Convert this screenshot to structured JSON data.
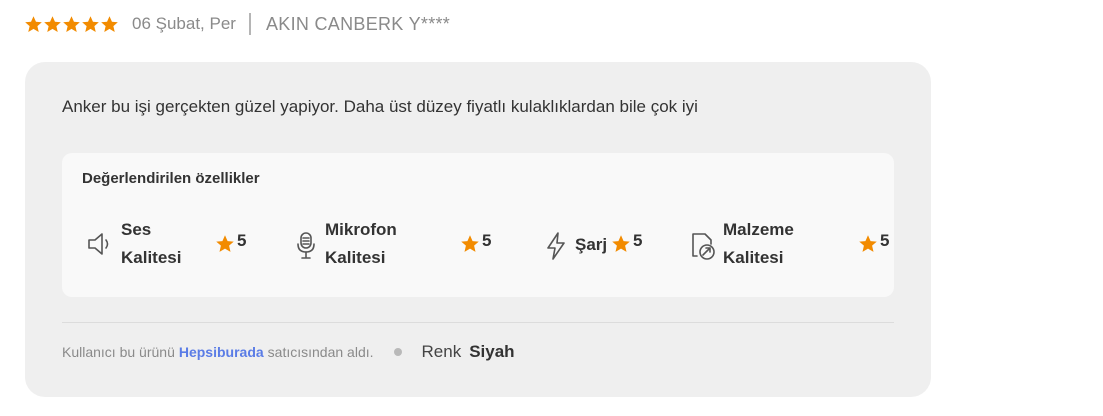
{
  "review": {
    "rating": 5,
    "rating_max": 5,
    "date": "06 Şubat, Per",
    "author": "AKIN CANBERK Y****",
    "comment": "Anker bu işi gerçekten güzel yapiyor. Daha üst düzey fiyatlı kulaklıklardan bile çok iyi"
  },
  "features": {
    "title": "Değerlendirilen özellikler",
    "items": [
      {
        "line1": "Ses",
        "line2": "Kalitesi",
        "score": "5",
        "icon": "speaker-icon"
      },
      {
        "line1": "Mikrofon",
        "line2": "Kalitesi",
        "score": "5",
        "icon": "microphone-icon"
      },
      {
        "line1": "Şarj",
        "line2": "",
        "score": "5",
        "icon": "lightning-icon"
      },
      {
        "line1": "Malzeme",
        "line2": "Kalitesi",
        "score": "5",
        "icon": "material-icon"
      }
    ]
  },
  "footer": {
    "seller_prefix": "Kullanıcı bu ürünü",
    "seller_name": "Hepsiburada",
    "seller_suffix": "satıcısından aldı.",
    "color_label": "Renk",
    "color_value": "Siyah"
  },
  "colors": {
    "star": "#f28b00",
    "link": "#5a7ce6",
    "card_bg": "#efefef"
  }
}
